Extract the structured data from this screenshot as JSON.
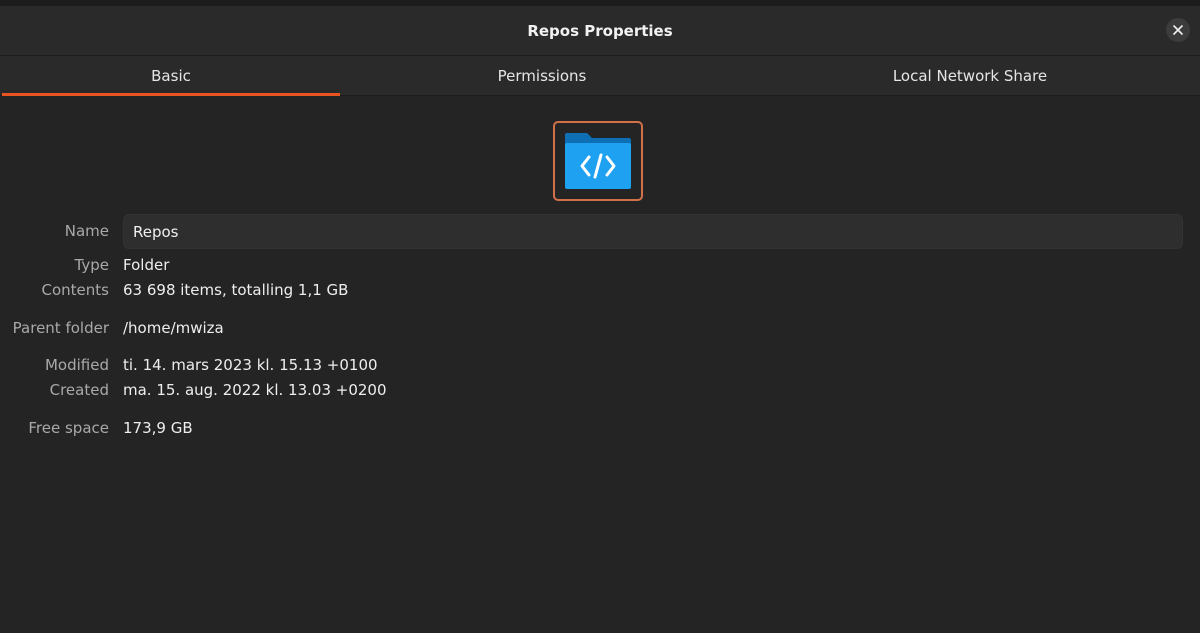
{
  "window": {
    "title": "Repos Properties"
  },
  "tabs": [
    {
      "label": "Basic",
      "active": true
    },
    {
      "label": "Permissions",
      "active": false
    },
    {
      "label": "Local Network Share",
      "active": false
    }
  ],
  "folder_icon": {
    "name": "folder-code-icon",
    "color": "#1ea1f1",
    "border_color": "#d0714a"
  },
  "fields": {
    "name_label": "Name",
    "name_value": "Repos",
    "type_label": "Type",
    "type_value": "Folder",
    "contents_label": "Contents",
    "contents_value": "63 698 items, totalling 1,1 GB",
    "parent_label": "Parent folder",
    "parent_value": "/home/mwiza",
    "modified_label": "Modified",
    "modified_value": "ti. 14. mars 2023 kl. 15.13 +0100",
    "created_label": "Created",
    "created_value": "ma. 15. aug. 2022 kl. 13.03 +0200",
    "free_label": "Free space",
    "free_value": "173,9 GB"
  },
  "accent_color": "#e95420"
}
